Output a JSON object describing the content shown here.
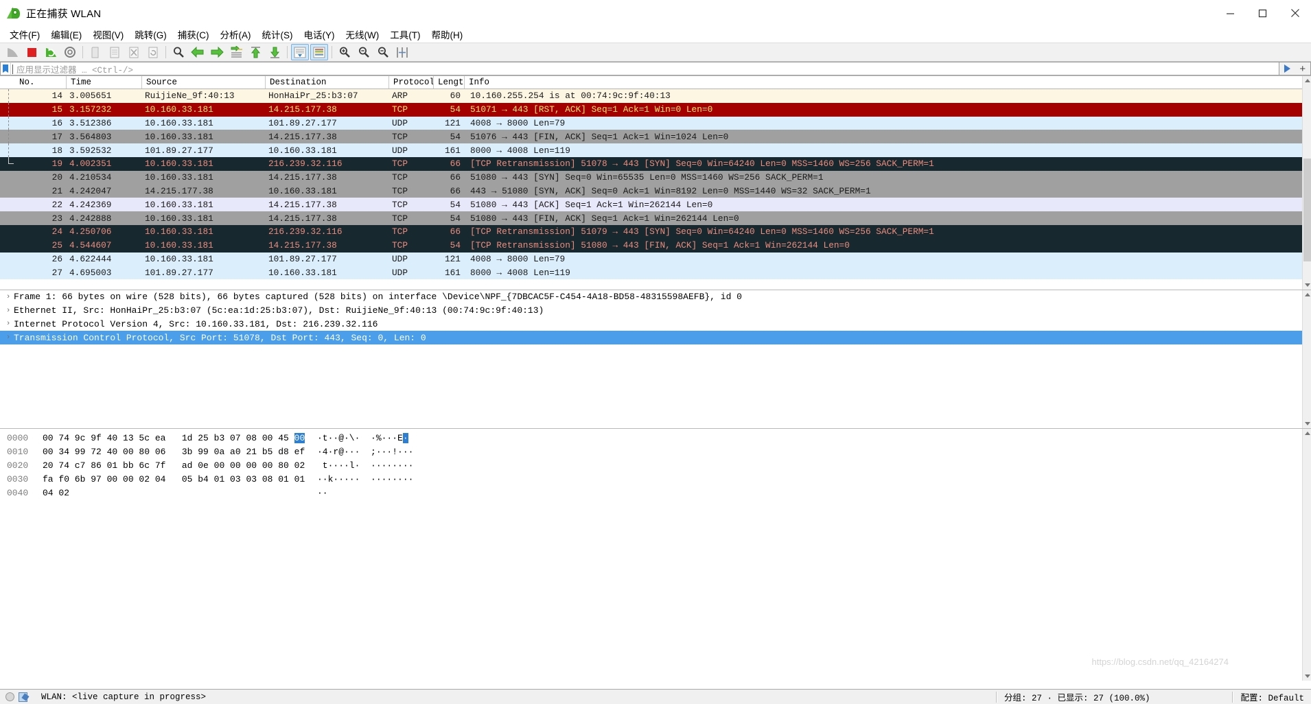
{
  "window": {
    "title": "正在捕获 WLAN",
    "icon": "wireshark-fin-icon",
    "minimize": "−",
    "maximize": "□",
    "close": "✕"
  },
  "menu": {
    "items": [
      {
        "label": "文件(F)",
        "name": "menu-file"
      },
      {
        "label": "编辑(E)",
        "name": "menu-edit"
      },
      {
        "label": "视图(V)",
        "name": "menu-view"
      },
      {
        "label": "跳转(G)",
        "name": "menu-go"
      },
      {
        "label": "捕获(C)",
        "name": "menu-capture"
      },
      {
        "label": "分析(A)",
        "name": "menu-analyze"
      },
      {
        "label": "统计(S)",
        "name": "menu-statistics"
      },
      {
        "label": "电话(Y)",
        "name": "menu-telephony"
      },
      {
        "label": "无线(W)",
        "name": "menu-wireless"
      },
      {
        "label": "工具(T)",
        "name": "menu-tools"
      },
      {
        "label": "帮助(H)",
        "name": "menu-help"
      }
    ]
  },
  "toolbar": {
    "buttons": [
      {
        "name": "start-capture-icon",
        "title": "开始捕获"
      },
      {
        "name": "stop-capture-icon",
        "title": "停止捕获"
      },
      {
        "name": "restart-capture-icon",
        "title": "重新开始捕获"
      },
      {
        "name": "capture-options-icon",
        "title": "捕获选项"
      },
      {
        "name": "open-file-icon",
        "title": "打开"
      },
      {
        "name": "save-file-icon",
        "title": "保存"
      },
      {
        "name": "close-file-icon",
        "title": "关闭"
      },
      {
        "name": "reload-file-icon",
        "title": "重新载入"
      },
      {
        "name": "find-packet-icon",
        "title": "查找分组"
      },
      {
        "name": "go-back-icon",
        "title": "上一个分组"
      },
      {
        "name": "go-forward-icon",
        "title": "下一个分组"
      },
      {
        "name": "go-to-packet-icon",
        "title": "转到分组"
      },
      {
        "name": "go-first-packet-icon",
        "title": "第一个分组"
      },
      {
        "name": "go-last-packet-icon",
        "title": "最后一个分组"
      },
      {
        "name": "auto-scroll-icon",
        "title": "自动滚动",
        "active": true
      },
      {
        "name": "colorize-icon",
        "title": "着色",
        "active": true
      },
      {
        "name": "zoom-in-icon",
        "title": "放大"
      },
      {
        "name": "zoom-out-icon",
        "title": "缩小"
      },
      {
        "name": "zoom-reset-icon",
        "title": "正常大小"
      },
      {
        "name": "resize-columns-icon",
        "title": "调整列宽"
      }
    ]
  },
  "filter": {
    "placeholder": "应用显示过滤器 … <Ctrl-/>",
    "value": "",
    "bookmark_icon": "filter-bookmark-icon",
    "apply_icon": "filter-apply-icon",
    "expand_icon": "filter-expand-icon"
  },
  "packet_list": {
    "columns": [
      {
        "key": "no",
        "label": "No."
      },
      {
        "key": "time",
        "label": "Time"
      },
      {
        "key": "src",
        "label": "Source"
      },
      {
        "key": "dst",
        "label": "Destination"
      },
      {
        "key": "prot",
        "label": "Protocol"
      },
      {
        "key": "len",
        "label": "Length"
      },
      {
        "key": "info",
        "label": "Info"
      }
    ],
    "rows": [
      {
        "no": "14",
        "time": "3.005651",
        "src": "RuijieNe_9f:40:13",
        "dst": "HonHaiPr_25:b3:07",
        "prot": "ARP",
        "len": "60",
        "info": "10.160.255.254 is at 00:74:9c:9f:40:13",
        "bg": "#fdf6e3",
        "fg": "#1a1a1a",
        "gutter": "dashed"
      },
      {
        "no": "15",
        "time": "3.157232",
        "src": "10.160.33.181",
        "dst": "14.215.177.38",
        "prot": "TCP",
        "len": "54",
        "info": "51071 → 443 [RST, ACK] Seq=1 Ack=1 Win=0 Len=0",
        "bg": "#a40000",
        "fg": "#ffe86a",
        "gutter": "dashed"
      },
      {
        "no": "16",
        "time": "3.512386",
        "src": "10.160.33.181",
        "dst": "101.89.27.177",
        "prot": "UDP",
        "len": "121",
        "info": "4008 → 8000 Len=79",
        "bg": "#daeefc",
        "fg": "#1a1a1a",
        "gutter": "dashed"
      },
      {
        "no": "17",
        "time": "3.564803",
        "src": "10.160.33.181",
        "dst": "14.215.177.38",
        "prot": "TCP",
        "len": "54",
        "info": "51076 → 443 [FIN, ACK] Seq=1 Ack=1 Win=1024 Len=0",
        "bg": "#a0a0a0",
        "fg": "#1a1a1a",
        "gutter": "dashed"
      },
      {
        "no": "18",
        "time": "3.592532",
        "src": "101.89.27.177",
        "dst": "10.160.33.181",
        "prot": "UDP",
        "len": "161",
        "info": "8000 → 4008 Len=119",
        "bg": "#daeefc",
        "fg": "#1a1a1a",
        "gutter": "dashed"
      },
      {
        "no": "19",
        "time": "4.002351",
        "src": "10.160.33.181",
        "dst": "216.239.32.116",
        "prot": "TCP",
        "len": "66",
        "info": "[TCP Retransmission] 51078 → 443 [SYN] Seq=0 Win=64240 Len=0 MSS=1460 WS=256 SACK_PERM=1",
        "bg": "#17292e",
        "fg": "#ef8b7d",
        "gutter": "corner"
      },
      {
        "no": "20",
        "time": "4.210534",
        "src": "10.160.33.181",
        "dst": "14.215.177.38",
        "prot": "TCP",
        "len": "66",
        "info": "51080 → 443 [SYN] Seq=0 Win=65535 Len=0 MSS=1460 WS=256 SACK_PERM=1",
        "bg": "#a0a0a0",
        "fg": "#1a1a1a",
        "gutter": "none"
      },
      {
        "no": "21",
        "time": "4.242047",
        "src": "14.215.177.38",
        "dst": "10.160.33.181",
        "prot": "TCP",
        "len": "66",
        "info": "443 → 51080 [SYN, ACK] Seq=0 Ack=1 Win=8192 Len=0 MSS=1440 WS=32 SACK_PERM=1",
        "bg": "#a0a0a0",
        "fg": "#1a1a1a",
        "gutter": "none"
      },
      {
        "no": "22",
        "time": "4.242369",
        "src": "10.160.33.181",
        "dst": "14.215.177.38",
        "prot": "TCP",
        "len": "54",
        "info": "51080 → 443 [ACK] Seq=1 Ack=1 Win=262144 Len=0",
        "bg": "#e8e8fb",
        "fg": "#1a1a1a",
        "gutter": "none"
      },
      {
        "no": "23",
        "time": "4.242888",
        "src": "10.160.33.181",
        "dst": "14.215.177.38",
        "prot": "TCP",
        "len": "54",
        "info": "51080 → 443 [FIN, ACK] Seq=1 Ack=1 Win=262144 Len=0",
        "bg": "#a0a0a0",
        "fg": "#1a1a1a",
        "gutter": "none"
      },
      {
        "no": "24",
        "time": "4.250706",
        "src": "10.160.33.181",
        "dst": "216.239.32.116",
        "prot": "TCP",
        "len": "66",
        "info": "[TCP Retransmission] 51079 → 443 [SYN] Seq=0 Win=64240 Len=0 MSS=1460 WS=256 SACK_PERM=1",
        "bg": "#17292e",
        "fg": "#ef8b7d",
        "gutter": "none"
      },
      {
        "no": "25",
        "time": "4.544607",
        "src": "10.160.33.181",
        "dst": "14.215.177.38",
        "prot": "TCP",
        "len": "54",
        "info": "[TCP Retransmission] 51080 → 443 [FIN, ACK] Seq=1 Ack=1 Win=262144 Len=0",
        "bg": "#17292e",
        "fg": "#ef8b7d",
        "gutter": "none"
      },
      {
        "no": "26",
        "time": "4.622444",
        "src": "10.160.33.181",
        "dst": "101.89.27.177",
        "prot": "UDP",
        "len": "121",
        "info": "4008 → 8000 Len=79",
        "bg": "#daeefc",
        "fg": "#1a1a1a",
        "gutter": "none"
      },
      {
        "no": "27",
        "time": "4.695003",
        "src": "101.89.27.177",
        "dst": "10.160.33.181",
        "prot": "UDP",
        "len": "161",
        "info": "8000 → 4008 Len=119",
        "bg": "#daeefc",
        "fg": "#1a1a1a",
        "gutter": "none"
      }
    ]
  },
  "details": {
    "rows": [
      {
        "text": "Frame 1: 66 bytes on wire (528 bits), 66 bytes captured (528 bits) on interface \\Device\\NPF_{7DBCAC5F-C454-4A18-BD58-48315598AEFB}, id 0",
        "selected": false,
        "name": "detail-row-frame"
      },
      {
        "text": "Ethernet II, Src: HonHaiPr_25:b3:07 (5c:ea:1d:25:b3:07), Dst: RuijieNe_9f:40:13 (00:74:9c:9f:40:13)",
        "selected": false,
        "name": "detail-row-ethernet"
      },
      {
        "text": "Internet Protocol Version 4, Src: 10.160.33.181, Dst: 216.239.32.116",
        "selected": false,
        "name": "detail-row-ipv4"
      },
      {
        "text": "Transmission Control Protocol, Src Port: 51078, Dst Port: 443, Seq: 0, Len: 0",
        "selected": true,
        "name": "detail-row-tcp"
      }
    ],
    "expander": "›"
  },
  "bytes": {
    "rows": [
      {
        "offset": "0000",
        "bytes_pre": "00 74 9c 9f 40 13 5c ea   1d 25 b3 07 08 00 45 ",
        "bytes_hl": "00",
        "ascii_pre": "·t··@·\\·  ·%···E",
        "ascii_hl": "·"
      },
      {
        "offset": "0010",
        "bytes_pre": "00 34 99 72 40 00 80 06   3b 99 0a a0 21 b5 d8 ef",
        "bytes_hl": "",
        "ascii_pre": "·4·r@···  ;···!···",
        "ascii_hl": ""
      },
      {
        "offset": "0020",
        "bytes_pre": "20 74 c7 86 01 bb 6c 7f   ad 0e 00 00 00 00 80 02",
        "bytes_hl": "",
        "ascii_pre": " t····l·  ········",
        "ascii_hl": ""
      },
      {
        "offset": "0030",
        "bytes_pre": "fa f0 6b 97 00 00 02 04   05 b4 01 03 03 08 01 01",
        "bytes_hl": "",
        "ascii_pre": "··k·····  ········",
        "ascii_hl": ""
      },
      {
        "offset": "0040",
        "bytes_pre": "04 02",
        "bytes_hl": "",
        "ascii_pre": "··",
        "ascii_hl": ""
      }
    ]
  },
  "statusbar": {
    "capture_text": "WLAN: <live capture in progress>",
    "packets_text": "分组: 27 · 已显示: 27 (100.0%)",
    "profile_text": "配置: Default",
    "expert_icon": "expert-info-icon",
    "capture_file_icon": "capture-file-properties-icon"
  },
  "watermark": "https://blog.csdn.net/qq_42164274"
}
